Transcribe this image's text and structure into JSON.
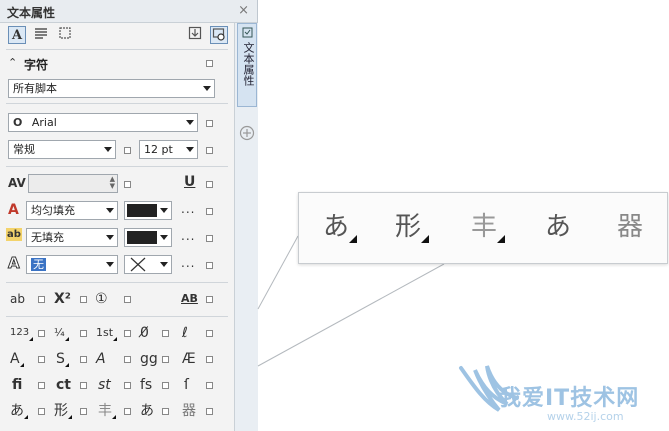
{
  "panel": {
    "title": "文本属性",
    "close_glyph": "×",
    "side_tab_label": "文本属性"
  },
  "section": {
    "title": "字符"
  },
  "script_select": "所有脚本",
  "font": {
    "name": "Arial",
    "style": "常规",
    "size": "12 pt"
  },
  "fill": {
    "text_fill": "均匀填充",
    "background_fill": "无填充",
    "outline": "无",
    "text_fill_color": "#222222",
    "background_fill_color": "#222222"
  },
  "dots": "...",
  "features": {
    "row1": [
      "ab",
      "X²",
      "①",
      "AB"
    ],
    "row2": [
      "123",
      "¼",
      "1st",
      "0̸",
      "ℓ"
    ],
    "row3": [
      "A",
      "S",
      "A",
      "gg",
      "Æ"
    ],
    "row4": [
      "fi",
      "ct",
      "st",
      "fs",
      "ſ"
    ],
    "row5": [
      "あ",
      "形",
      "丰",
      "あ",
      "器"
    ]
  },
  "zoom_glyphs": [
    "あ",
    "形",
    "丰",
    "あ",
    "器"
  ],
  "watermark": {
    "title": "我爱IT技术网",
    "url": "www.52ij.com"
  },
  "colors": {
    "accent": "#6a8fb7",
    "tab_active_bg": "#dbe8f5",
    "watermark": "#9ec3e3"
  }
}
